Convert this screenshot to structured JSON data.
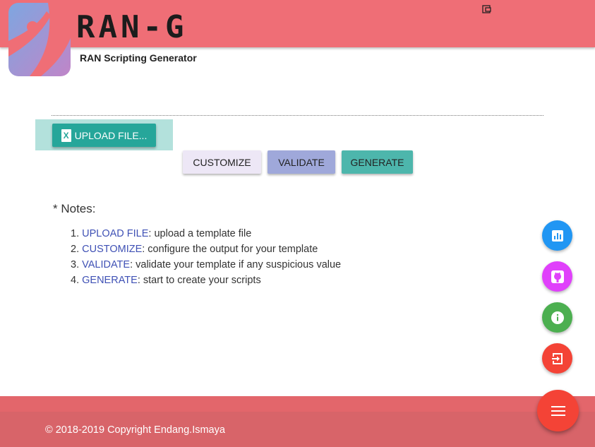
{
  "header": {
    "title": "RAN-G",
    "subtitle": "RAN Scripting Generator",
    "logo_icon": "rang-logo-icon",
    "corner_icon": "window-icon",
    "color": "#ef6e76"
  },
  "upload": {
    "label": "UPLOAD FILE...",
    "icon": "excel-file-icon",
    "icon_glyph": "X"
  },
  "actions": {
    "customize": "CUSTOMIZE",
    "validate": "VALIDATE",
    "generate": "GENERATE"
  },
  "notes": {
    "title": "* Notes:",
    "items": [
      {
        "num": "1.",
        "keyword": "UPLOAD FILE",
        "text": ": upload a template file"
      },
      {
        "num": "2.",
        "keyword": "CUSTOMIZE",
        "text": ": configure the output for your template"
      },
      {
        "num": "3.",
        "keyword": "VALIDATE",
        "text": ": validate your template if any suspicious value"
      },
      {
        "num": "4.",
        "keyword": "GENERATE",
        "text": ": start to create your scripts"
      }
    ]
  },
  "fabs": [
    {
      "icon": "bar-chart-icon",
      "color": "#2196f3"
    },
    {
      "icon": "github-icon",
      "color": "#e040fb"
    },
    {
      "icon": "info-icon",
      "color": "#4caf50"
    },
    {
      "icon": "logout-icon",
      "color": "#f44336"
    },
    {
      "icon": "menu-icon",
      "color": "#f44336"
    }
  ],
  "footer": {
    "copyright": "© 2018-2019 Copyright Endang.Ismaya"
  }
}
